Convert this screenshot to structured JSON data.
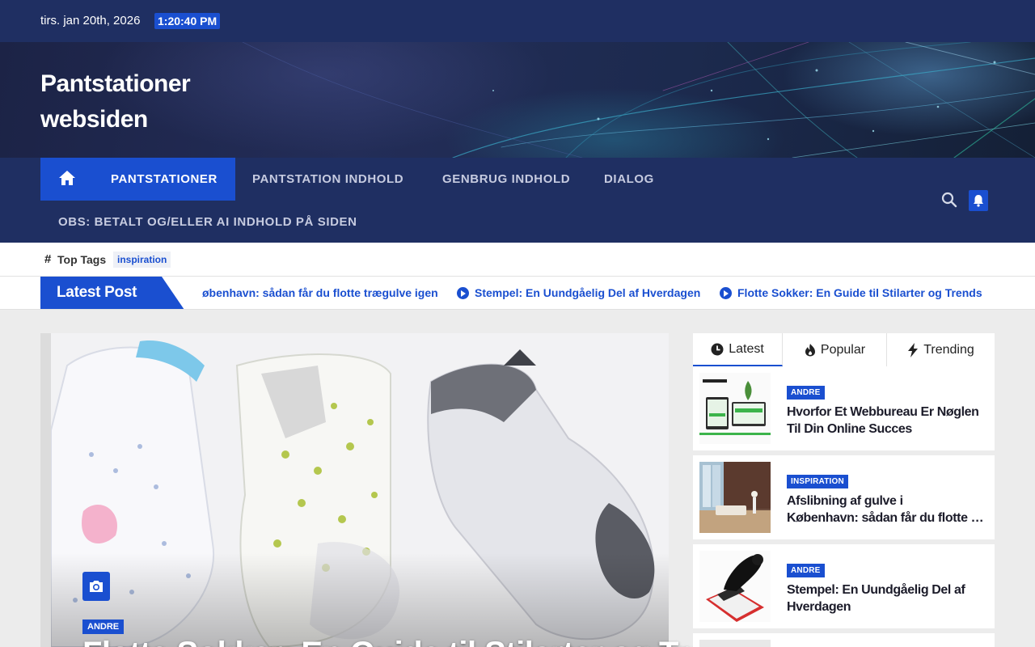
{
  "topbar": {
    "date": "tirs. jan 20th, 2026",
    "time": "1:20:40 PM"
  },
  "site": {
    "title_line1": "Pantstationer",
    "title_line2": "websiden"
  },
  "nav": {
    "home_icon": "home-icon",
    "items": [
      {
        "label": "PANTSTATIONER",
        "active": true
      },
      {
        "label": "PANTSTATION INDHOLD"
      },
      {
        "label": "GENBRUG INDHOLD"
      },
      {
        "label": "DIALOG"
      },
      {
        "label": "OBS: BETALT OG/ELLER AI INDHOLD PÅ SIDEN"
      }
    ],
    "search_icon": "search-icon",
    "bell_icon": "bell-icon"
  },
  "tags": {
    "label": "Top Tags",
    "items": [
      "inspiration"
    ]
  },
  "ticker": {
    "label": "Latest Post",
    "items": [
      "øbenhavn: sådan får du flotte trægulve igen",
      "Stempel: En Uundgåelig Del af Hverdagen",
      "Flotte Sokker: En Guide til Stilarter og Trends"
    ]
  },
  "feature": {
    "badge": "ANDRE",
    "title": "Flotte Sokker: En Guide til Stilarter og Trends"
  },
  "sidebar": {
    "tabs": [
      {
        "label": "Latest",
        "icon": "clock-icon"
      },
      {
        "label": "Popular",
        "icon": "fire-icon"
      },
      {
        "label": "Trending",
        "icon": "bolt-icon"
      }
    ],
    "posts": [
      {
        "badge": "ANDRE",
        "title": "Hvorfor Et Webbureau Er Nøglen Til Din Online Succes"
      },
      {
        "badge": "INSPIRATION",
        "title_line1": "Afslibning af gulve i",
        "title_line2": "København: sådan får du flotte trægulve igen"
      },
      {
        "badge": "ANDRE",
        "title": "Stempel: En Uundgåelig Del af Hverdagen"
      }
    ]
  },
  "colors": {
    "navy": "#1f2f62",
    "accent": "#1a4fd0"
  }
}
